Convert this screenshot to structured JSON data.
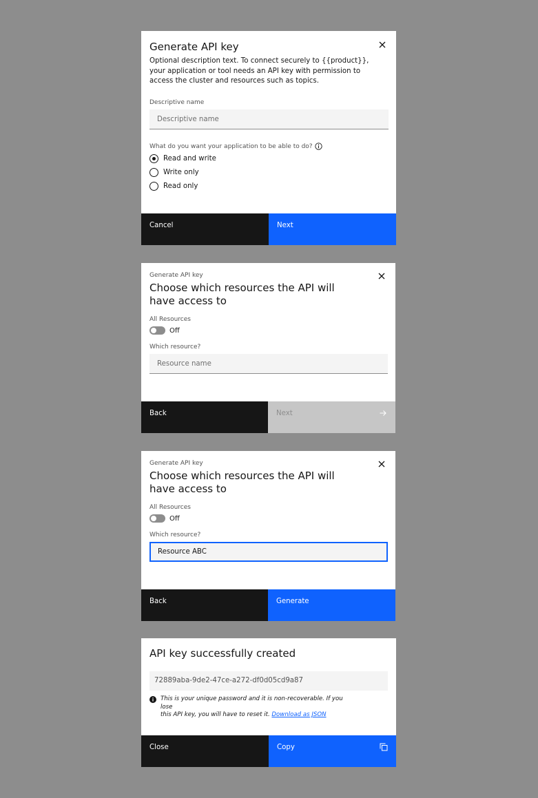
{
  "modal1": {
    "title": "Generate API key",
    "description": "Optional description text. To connect securely to {{product}}, your application or tool needs an API key with permission to access the cluster and resources such as topics.",
    "name_label": "Descriptive name",
    "name_placeholder": "Descriptive name",
    "question": "What do you want your application to be able to do?",
    "options": [
      {
        "label": "Read and write",
        "checked": true
      },
      {
        "label": "Write only",
        "checked": false
      },
      {
        "label": "Read only",
        "checked": false
      }
    ],
    "cancel_label": "Cancel",
    "next_label": "Next"
  },
  "modal2": {
    "eyebrow": "Generate API key",
    "title_line1": "Choose which resources the API will",
    "title_line2": "have access to",
    "all_resources_label": "All Resources",
    "toggle_state": "Off",
    "which_label": "Which resource?",
    "resource_placeholder": "Resource name",
    "back_label": "Back",
    "next_label": "Next"
  },
  "modal3": {
    "eyebrow": "Generate API key",
    "title_line1": "Choose which resources the API will",
    "title_line2": "have access to",
    "all_resources_label": "All Resources",
    "toggle_state": "Off",
    "which_label": "Which resource?",
    "resource_value": "Resource ABC",
    "back_label": "Back",
    "generate_label": "Generate"
  },
  "modal4": {
    "title": "API key successfully created",
    "api_key": "72889aba-9de2-47ce-a272-df0d05cd9a87",
    "info_text_1": "This is your unique password and it is non-recoverable. If you lose",
    "info_text_2": "this API key, you will have to reset it.",
    "download_link": "Download as JSON",
    "close_label": "Close",
    "copy_label": "Copy"
  },
  "colors": {
    "primary": "#0f62fe",
    "secondary": "#161616",
    "disabled": "#c6c6c6",
    "backdrop": "#8d8d8d"
  }
}
